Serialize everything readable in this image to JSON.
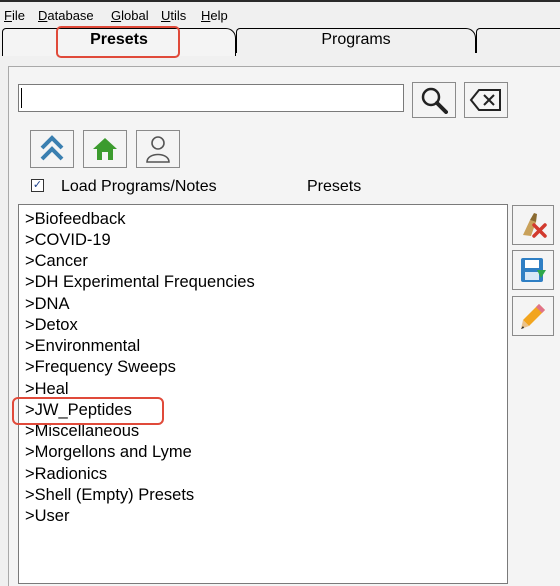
{
  "menu": [
    {
      "label": "File"
    },
    {
      "label": "Database"
    },
    {
      "label": "Global"
    },
    {
      "label": "Utils"
    },
    {
      "label": "Help"
    }
  ],
  "tabs": [
    {
      "label": "Presets",
      "active": true
    },
    {
      "label": "Programs",
      "active": false
    },
    {
      "label": "",
      "active": false
    }
  ],
  "search": {
    "value": "",
    "placeholder": ""
  },
  "toolbar_icons": [
    "search-icon",
    "clear-icon",
    "up-icon",
    "home-icon",
    "user-icon"
  ],
  "load_programs": {
    "label": "Load Programs/Notes",
    "checked": true
  },
  "list_title": "Presets",
  "presets": [
    ">Biofeedback",
    ">COVID-19",
    ">Cancer",
    ">DH Experimental Frequencies",
    ">DNA",
    ">Detox",
    ">Environmental",
    ">Frequency Sweeps",
    ">Heal",
    ">JW_Peptides",
    ">Miscellaneous",
    ">Morgellons and Lyme",
    ">Radionics",
    ">Shell (Empty) Presets",
    ">User"
  ],
  "side_actions": [
    "delete-icon",
    "save-icon",
    "edit-icon"
  ],
  "highlight_color": "#e04a3a"
}
